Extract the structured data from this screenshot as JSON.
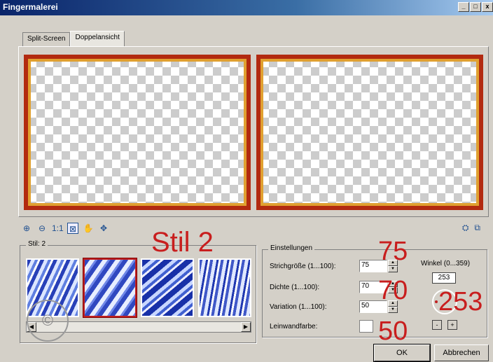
{
  "window": {
    "title": "Fingermalerei",
    "min": "_",
    "max": "□",
    "close": "x"
  },
  "tabs": [
    "Split-Screen",
    "Doppelansicht"
  ],
  "stil": {
    "legend": "Stil: 2",
    "annotation": "Stil 2"
  },
  "settings": {
    "legend": "Einstellungen",
    "size_label": "Strichgröße (1...100):",
    "size_value": "75",
    "density_label": "Dichte (1...100):",
    "density_value": "70",
    "variation_label": "Variation (1...100):",
    "variation_value": "50",
    "canvas_label": "Leinwandfarbe:",
    "angle_label": "Winkel (0...359)",
    "angle_value": "253",
    "minus": "-",
    "plus": "+"
  },
  "annotations": {
    "size": "75",
    "density": "70",
    "variation": "50",
    "angle": "253"
  },
  "buttons": {
    "ok": "OK",
    "cancel": "Abbrechen"
  },
  "stamp": "©"
}
